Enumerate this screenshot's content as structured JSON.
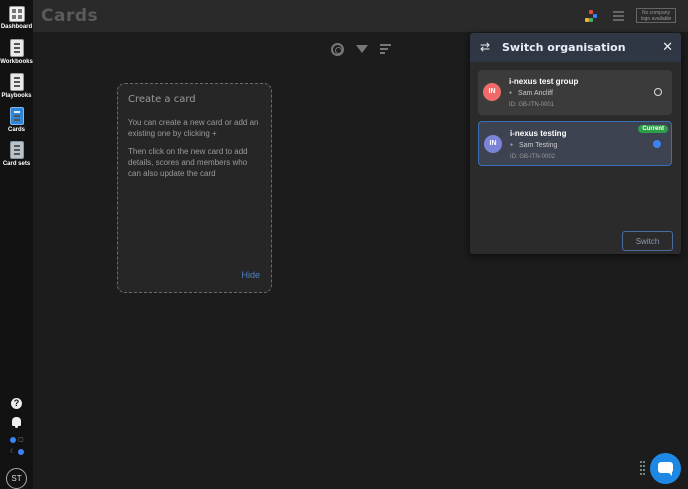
{
  "header": {
    "title": "Cards",
    "logo_text": "No company logo available"
  },
  "sidebar": {
    "items": [
      {
        "label": "Dashboard"
      },
      {
        "label": "Workbooks"
      },
      {
        "label": "Playbooks"
      },
      {
        "label": "Cards"
      },
      {
        "label": "Card sets"
      }
    ],
    "help_symbol": "?",
    "avatar_initials": "ST"
  },
  "create_card": {
    "title": "Create a card",
    "line1": "You can create a new card or add an existing one by clicking +",
    "line2": "Then click on the new card to add details, scores and members who can also update the card",
    "hide_label": "Hide"
  },
  "modal": {
    "title": "Switch organisation",
    "close_symbol": "✕",
    "swap_symbol": "⇄",
    "switch_label": "Switch",
    "organisations": [
      {
        "initials": "IN",
        "name": "i-nexus test group",
        "user": "Sam Ancliff",
        "id": "ID: GB-ITN-0001",
        "current": false,
        "badge_color": "#f06a6a"
      },
      {
        "initials": "IN",
        "name": "i-nexus testing",
        "user": "Sam Testing",
        "id": "ID: GB-ITN-0002",
        "current": true,
        "current_label": "Current",
        "badge_color": "#7b84d9"
      }
    ]
  },
  "colors": {
    "accent": "#3b82f6",
    "current_badge": "#2f9e4a",
    "chat": "#1e88e5"
  }
}
